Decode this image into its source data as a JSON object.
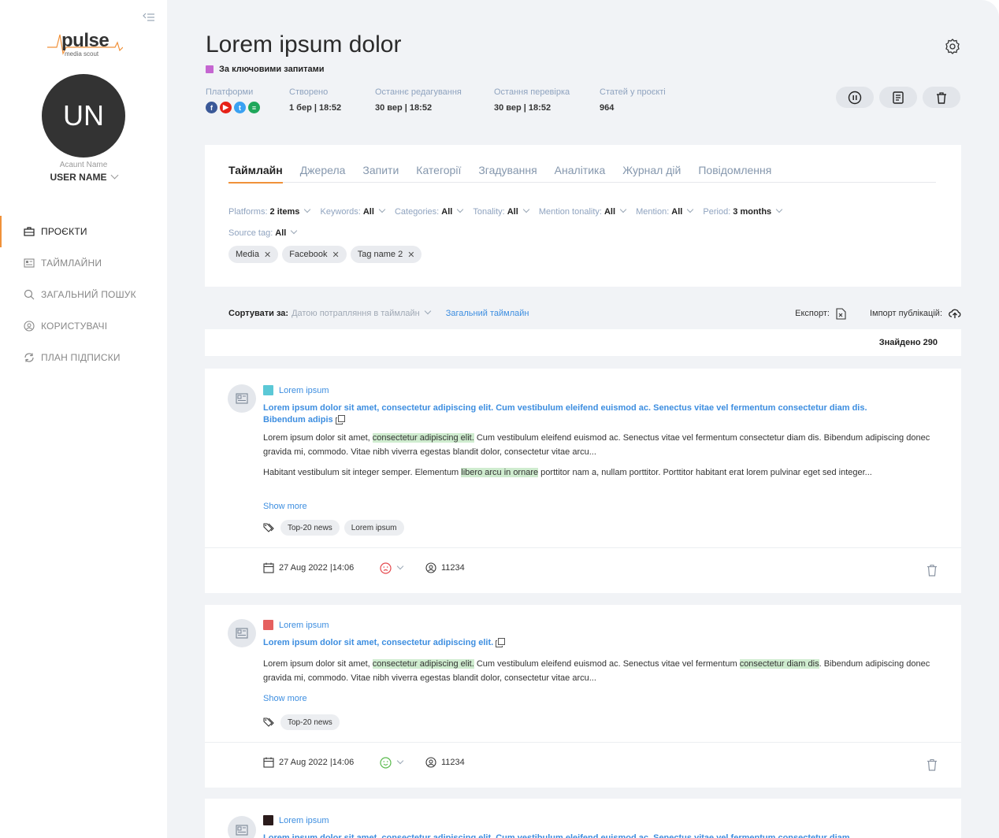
{
  "sidebar": {
    "logo": {
      "word": "pulse",
      "sub": "media scout"
    },
    "avatar_initials": "UN",
    "account_label": "Acaunt Name",
    "user_name": "USER NAME",
    "nav": [
      {
        "label": "ПРОЄКТИ",
        "icon": "briefcase-icon",
        "active": true
      },
      {
        "label": "ТАЙМЛАЙНИ",
        "icon": "news-icon",
        "active": false
      },
      {
        "label": "ЗАГАЛЬНИЙ ПОШУК",
        "icon": "search-icon",
        "active": false
      },
      {
        "label": "КОРИСТУВАЧІ",
        "icon": "user-icon",
        "active": false
      },
      {
        "label": "ПЛАН ПІДПИСКИ",
        "icon": "refresh-icon",
        "active": false
      }
    ]
  },
  "header": {
    "title": "Lorem ipsum dolor",
    "keyword_mode": "За ключовими запитами",
    "keyword_color": "#c566d1",
    "meta": [
      {
        "label": "Платформи",
        "value": ""
      },
      {
        "label": "Створено",
        "value": "1 бер | 18:52"
      },
      {
        "label": "Останнє редагування",
        "value": "30 вер | 18:52"
      },
      {
        "label": "Остання перевірка",
        "value": "30 вер | 18:52"
      },
      {
        "label": "Статей у проєкті",
        "value": "964"
      }
    ],
    "platform_icons": [
      "facebook-icon",
      "youtube-icon",
      "twitter-icon",
      "news-icon"
    ]
  },
  "tabs": [
    "Таймлайн",
    "Джерела",
    "Запити",
    "Категорії",
    "Згадування",
    "Аналітика",
    "Журнал дій",
    "Повідомлення"
  ],
  "filters": [
    {
      "label": "Platforms:",
      "value": "2 items"
    },
    {
      "label": "Keywords:",
      "value": "All"
    },
    {
      "label": "Categories:",
      "value": "All"
    },
    {
      "label": "Tonality:",
      "value": "All"
    },
    {
      "label": "Mention tonality:",
      "value": "All"
    },
    {
      "label": "Mention:",
      "value": "All"
    },
    {
      "label": "Period:",
      "value": "3 months"
    },
    {
      "label": "Source tag:",
      "value": "All"
    }
  ],
  "chips": [
    "Media",
    "Facebook",
    "Tag name 2"
  ],
  "sort": {
    "label": "Сортувати за:",
    "value": "Датою потрапляння в таймлайн",
    "link": "Загальний таймлайн",
    "export_label": "Експорт:",
    "import_label": "Імпорт публікацій:"
  },
  "found": "Знайдено 290",
  "posts": [
    {
      "source": "Lorem ipsum",
      "source_color": "#5bc8d6",
      "title": "Lorem ipsum dolor sit amet, consectetur adipiscing elit. Cum vestibulum eleifend euismod ac. Senectus vitae vel fermentum consectetur diam dis. Bibendum adipis",
      "p1": [
        "Lorem ipsum dolor sit amet, ",
        "consectetur adipiscing elit.",
        " Cum vestibulum eleifend euismod ac. Senectus vitae vel fermentum consectetur diam dis. Bibendum adipiscing donec gravida mi, commodo. Vitae nibh viverra egestas blandit dolor, consectetur vitae arcu..."
      ],
      "p2": [
        "Habitant vestibulum sit integer semper. Elementum ",
        "libero arcu in ornare",
        " porttitor nam a, nullam porttitor. Porttitor habitant erat lorem pulvinar eget sed integer..."
      ],
      "show_more": "Show more",
      "tags": [
        "Top-20 news",
        "Lorem ipsum"
      ],
      "date": "27 Aug 2022 |14:06",
      "tone": "negative",
      "tone_color": "#e5484d",
      "reach": "11234"
    },
    {
      "source": "Lorem ipsum",
      "source_color": "#e5605f",
      "title": "Lorem ipsum dolor sit amet, consectetur adipiscing elit.",
      "p1": [
        "Lorem ipsum dolor sit amet, ",
        "consectetur adipiscing elit.",
        " Cum vestibulum eleifend euismod ac. Senectus vitae vel fermentum ",
        "consectetur diam dis",
        ". Bibendum adipiscing donec gravida mi, commodo. Vitae nibh viverra egestas blandit dolor, consectetur vitae arcu..."
      ],
      "show_more": "Show more",
      "tags": [
        "Top-20 news"
      ],
      "date": "27 Aug 2022 |14:06",
      "tone": "positive",
      "tone_color": "#57b94a",
      "reach": "11234"
    },
    {
      "source": "Lorem ipsum",
      "source_color": "#2b1b1b",
      "title": "Lorem ipsum dolor sit amet, consectetur adipiscing elit. Cum vestibulum eleifend euismod ac. Senectus vitae vel fermentum consectetur diam"
    }
  ]
}
